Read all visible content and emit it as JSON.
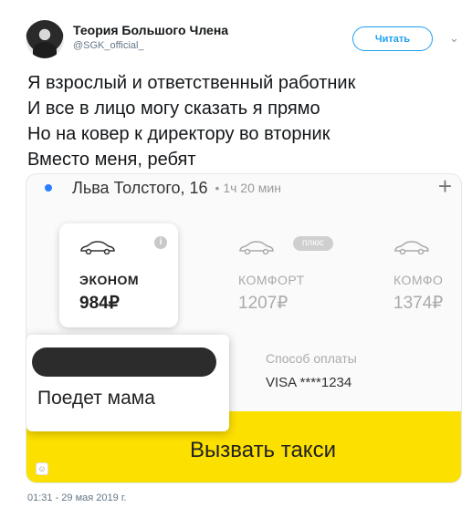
{
  "author": {
    "name": "Теория Большого Члена",
    "handle": "@SGK_official_"
  },
  "follow_label": "Читать",
  "tweet_lines": [
    "Я взрослый и ответственный работник",
    "И все в лицо могу сказать я прямо",
    "Но на ковер к директору во вторник",
    "Вместо меня, ребят"
  ],
  "media": {
    "route": {
      "address": "Льва Толстого, 16",
      "eta": "• 1ч 20 мин",
      "plus": "+"
    },
    "tariffs": [
      {
        "name": "ЭКОНОМ",
        "price": "984₽",
        "selected": true
      },
      {
        "name": "КОМФОРТ",
        "price": "1207₽",
        "selected": false
      },
      {
        "name": "КОМФО",
        "price": "1374₽",
        "selected": false
      }
    ],
    "plus_badge": "плюс",
    "info_icon": "i",
    "payment": {
      "label": "Способ оплаты",
      "value": "VISA ****1234"
    },
    "popup_text": "Поедет мама",
    "call_button": "Вызвать такси",
    "accent_color": "#fce000"
  },
  "timestamp": "01:31 - 29 мая 2019 г."
}
